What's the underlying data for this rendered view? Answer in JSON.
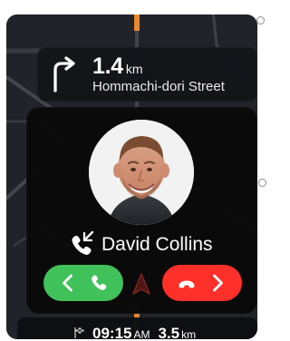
{
  "navigation": {
    "distance_value": "1.4",
    "distance_unit": "km",
    "street": "Hommachi-dori Street",
    "turn_icon": "right-turn-arrow"
  },
  "call": {
    "caller_name": "David Collins",
    "call_icon": "incoming-call",
    "accept_icon": "phone",
    "decline_icon": "phone-hangup"
  },
  "eta": {
    "time": "09:15",
    "ampm": "AM",
    "distance_value": "3.5",
    "distance_unit": "km",
    "flag_icon": "finish-flag"
  },
  "colors": {
    "accept": "#40c15a",
    "decline": "#ff2f2a",
    "background": "#1f2227",
    "route": "#f48b2c"
  }
}
